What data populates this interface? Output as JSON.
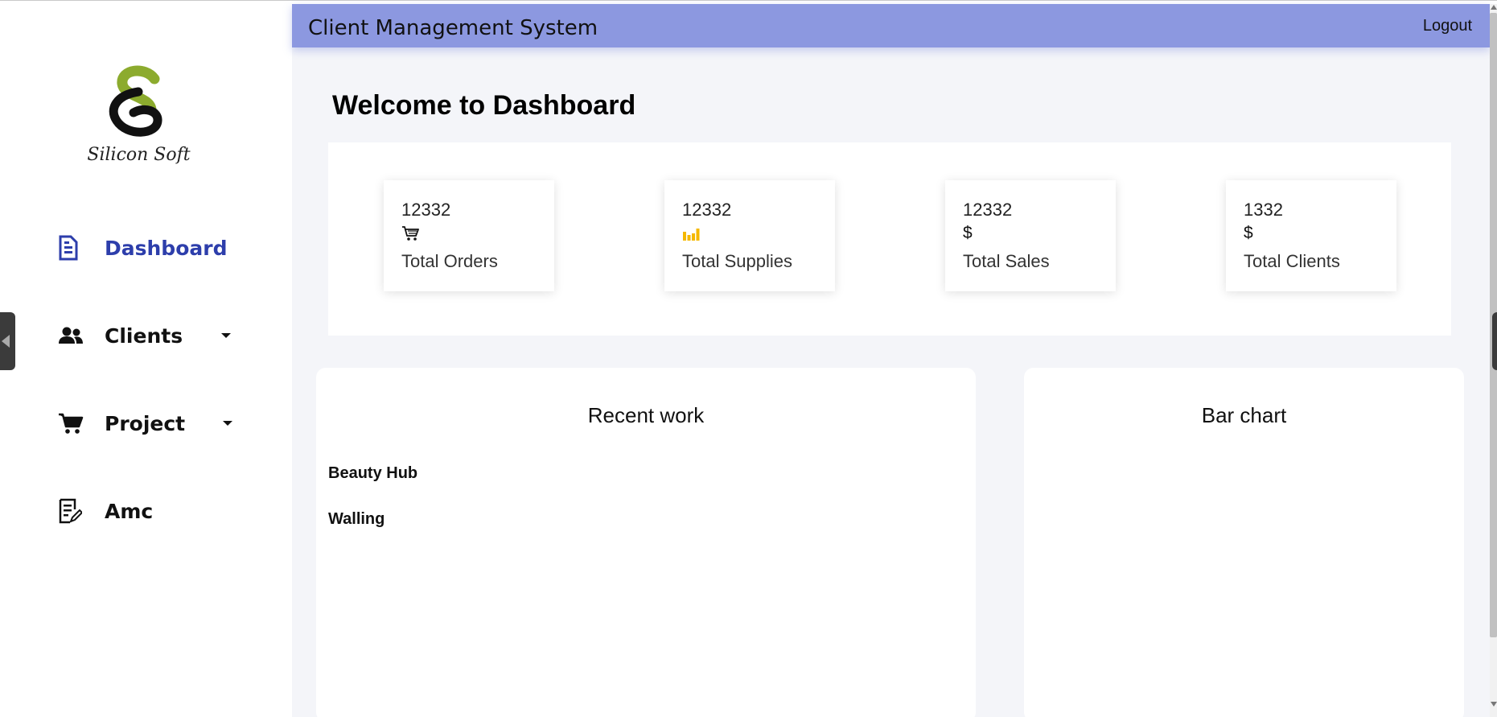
{
  "app": {
    "header_title": "Client Management System",
    "logout_label": "Logout"
  },
  "logo": {
    "text": "Silicon Soft"
  },
  "sidebar": {
    "items": [
      {
        "label": "Dashboard",
        "icon": "document-icon",
        "active": true
      },
      {
        "label": "Clients",
        "icon": "users-icon",
        "has_dropdown": true
      },
      {
        "label": "Project",
        "icon": "cart-icon",
        "has_dropdown": true
      },
      {
        "label": "Amc",
        "icon": "edit-document-icon"
      }
    ]
  },
  "dashboard": {
    "welcome": "Welcome to Dashboard",
    "stats": [
      {
        "value": "12332",
        "icon": "cart-icon",
        "label": "Total Orders"
      },
      {
        "value": "12332",
        "icon": "bar-chart-icon",
        "label": "Total Supplies"
      },
      {
        "value": "12332",
        "icon": "dollar-icon",
        "label": "Total Sales"
      },
      {
        "value": "1332",
        "icon": "dollar-icon",
        "label": "Total Clients"
      }
    ],
    "recent_work": {
      "title": "Recent work",
      "items": [
        "Beauty Hub",
        "Walling"
      ]
    },
    "bar_chart": {
      "title": "Bar chart"
    }
  },
  "colors": {
    "header_bg": "#8c98e0",
    "active_nav": "#2d3eab",
    "supplies_icon": "#f5b800",
    "logo_green": "#8cab2e"
  }
}
